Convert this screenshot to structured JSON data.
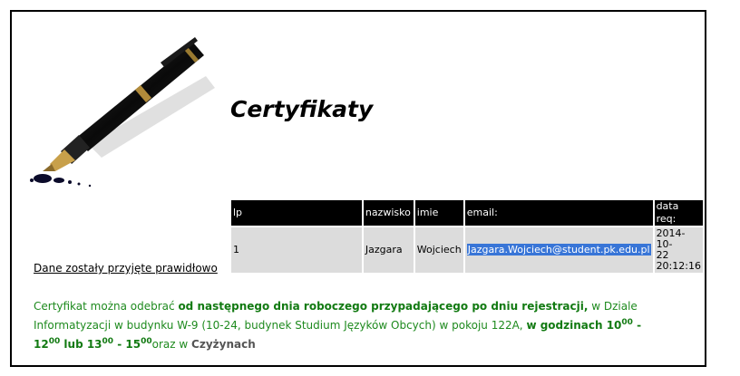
{
  "page": {
    "title": "Certyfikaty"
  },
  "table": {
    "headers": [
      "lp",
      "nazwisko",
      "imie",
      "email:",
      "data req:"
    ],
    "rows": [
      {
        "lp": "1",
        "nazwisko": "Jazgara",
        "imie": "Wojciech",
        "email": "Jazgara.Wojciech@student.pk.edu.pl",
        "date": "2014-10-22",
        "date_line1": "2014-10-",
        "date_line2": "22",
        "time": "20:12:16"
      }
    ]
  },
  "messages": {
    "success": "Dane zostały przyjęte prawidłowo",
    "info_1": "Certyfikat można odebrać ",
    "info_2": "od następnego dnia roboczego przypadającego po dniu rejestracji,",
    "info_3": " w Dziale Informatyzacji w budynku W-9 (10-24, budynek Studium Języków Obcych) w pokoju 122A, ",
    "info_4": "w godzinach 10",
    "sup_1": "00",
    "info_5": " - 12",
    "sup_2": "00",
    "info_6": " lub 13",
    "sup_3": "00",
    "info_7": " - 15",
    "sup_4": "00",
    "info_8": "oraz w ",
    "info_9": "Czyżynach"
  },
  "colors": {
    "header_bg": "#000000",
    "cell_bg": "#dcdcdc",
    "selection": "#3875d7",
    "info_text": "#1e8a1e"
  },
  "icons": [
    "fountain-pen-illustration"
  ]
}
